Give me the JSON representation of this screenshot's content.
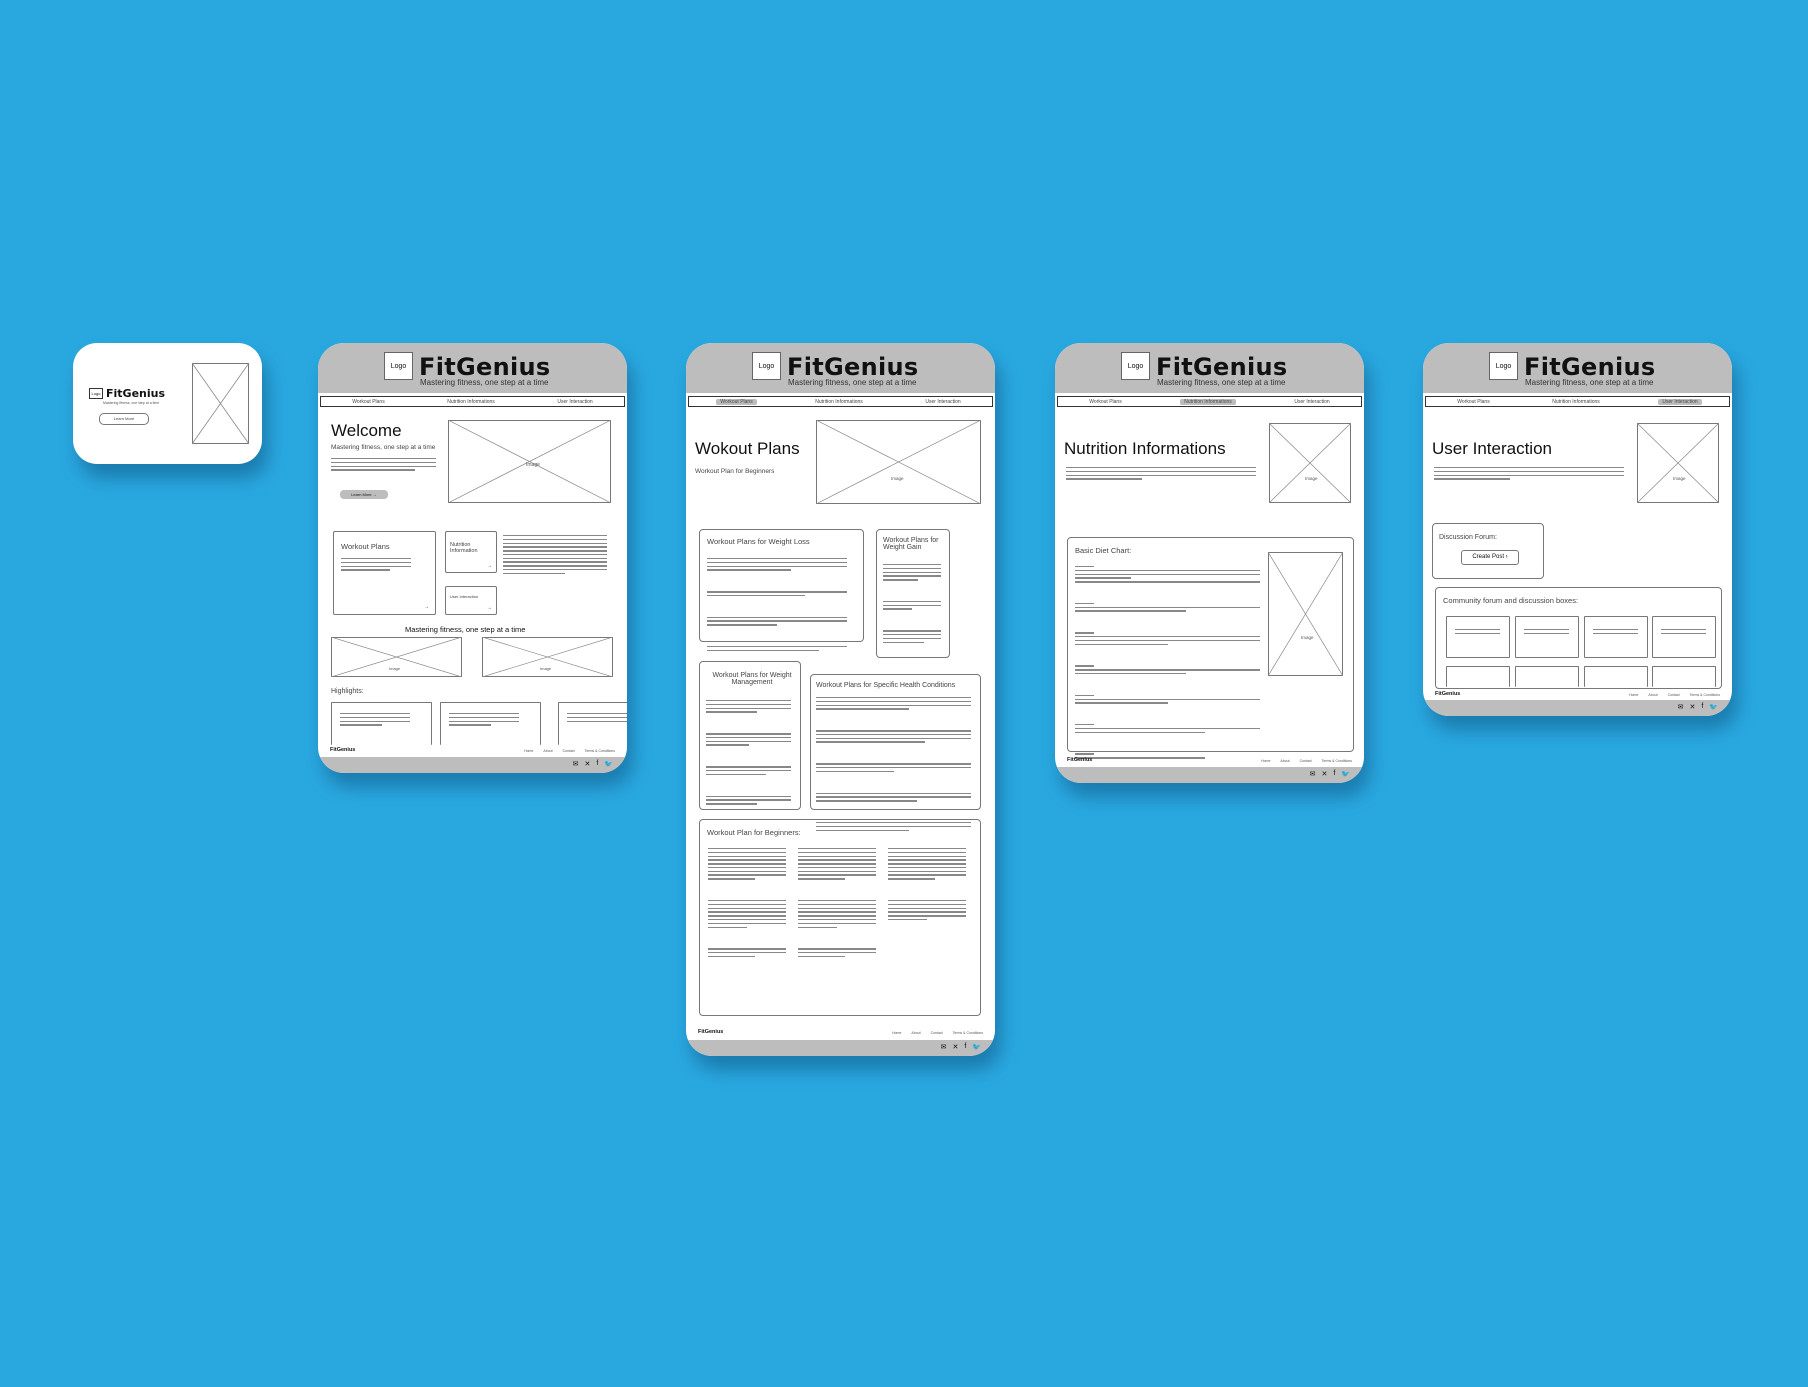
{
  "brand": "FitGenius",
  "tagline": "Mastering fitness, one step at a time",
  "logo_label": "Logo",
  "image_label": "Image",
  "nav": [
    "Workout Plans",
    "Nutrition Informations",
    "User Interaction"
  ],
  "splash": {
    "button": "Learn More"
  },
  "home": {
    "title": "Welcome",
    "subtitle": "Mastering fitness, one step at a time",
    "cta": "Learn More →",
    "workout_card": "Workout Plans",
    "nutrition_card": "Nutrition Information",
    "user_card": "User Interaction",
    "section_title": "Mastering fitness, one step at a time",
    "highlights": "Highlights:"
  },
  "workout": {
    "title": "Wokout Plans",
    "subtitle": "Workout Plan for Beginners",
    "weight_loss": "Workout Plans for Weight Loss",
    "weight_gain": "Workout Plans for Weight Gain",
    "weight_mgmt": "Workout Plans for Weight Management",
    "health": "Workout Plans for Specific Health Conditions",
    "beginners": "Workout Plan for Beginners:"
  },
  "nutrition": {
    "title": "Nutrition Informations",
    "diet_chart": "Basic Diet Chart:"
  },
  "user": {
    "title": "User Interaction",
    "forum": "Discussion Forum:",
    "create_post": "Create Post",
    "community": "Community forum and discussion boxes:"
  },
  "footer": {
    "brand": "FitGenius",
    "links": [
      "Home",
      "About",
      "Contact",
      "Terms & Conditions"
    ],
    "icons": [
      "mail-icon",
      "x-icon",
      "facebook-icon",
      "twitter-icon"
    ]
  }
}
